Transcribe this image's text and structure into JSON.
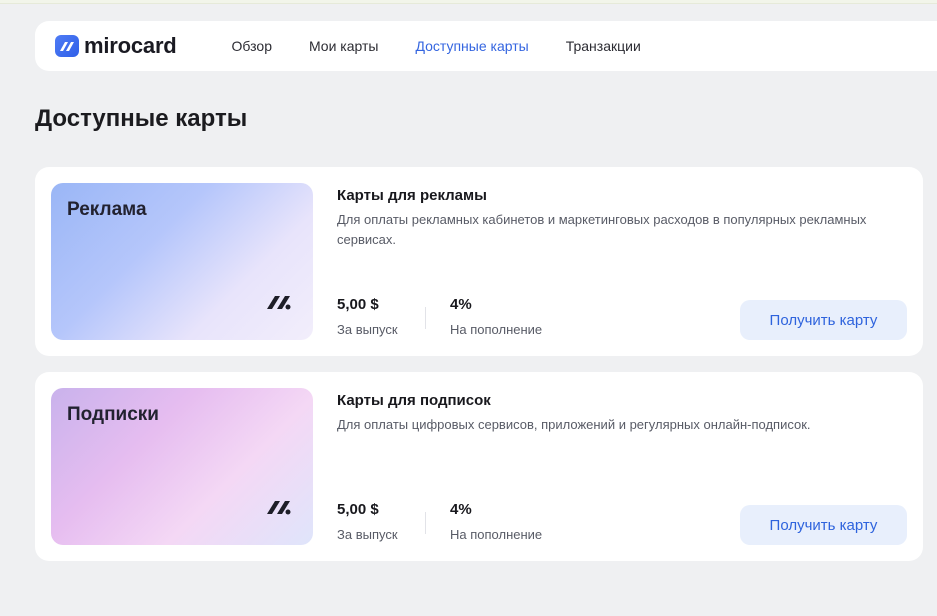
{
  "brand": {
    "name": "mirocard",
    "accent": "#3465e0"
  },
  "nav": [
    {
      "label": "Обзор",
      "active": false
    },
    {
      "label": "Мои карты",
      "active": false
    },
    {
      "label": "Доступные карты",
      "active": true
    },
    {
      "label": "Транзакции",
      "active": false
    }
  ],
  "page": {
    "title": "Доступные карты"
  },
  "offers": [
    {
      "card_name": "Реклама",
      "title": "Карты для рекламы",
      "description": "Для оплаты рекламных кабинетов и маркетинговых расходов в популярных рекламных сервисах.",
      "issue_fee": "5,00 $",
      "issue_fee_label": "За выпуск",
      "topup_fee": "4%",
      "topup_fee_label": "На пополнение",
      "button_label": "Получить карту"
    },
    {
      "card_name": "Подписки",
      "title": "Карты для подписок",
      "description": "Для оплаты цифровых сервисов, приложений и регулярных онлайн-подписок.",
      "issue_fee": "5,00 $",
      "issue_fee_label": "За выпуск",
      "topup_fee": "4%",
      "topup_fee_label": "На пополнение",
      "button_label": "Получить карту"
    }
  ]
}
